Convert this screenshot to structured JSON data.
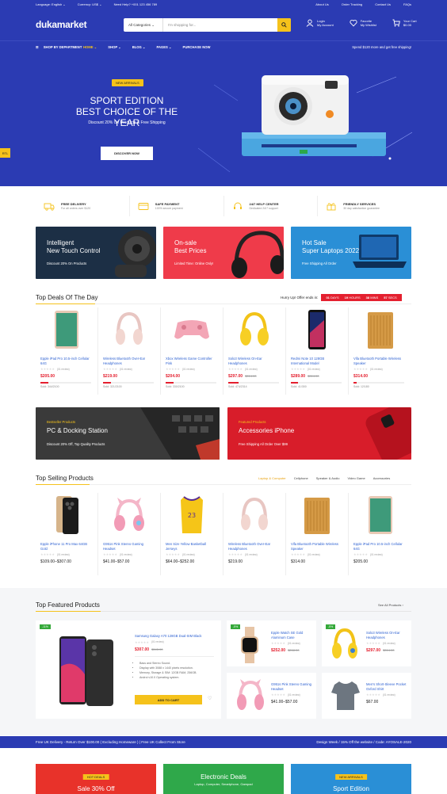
{
  "topbar": {
    "language": "Language: English ⌄",
    "currency": "Currency: US$ ⌄",
    "help": "Need Help? +001 123 456 789",
    "links": [
      "About Us",
      "Order Tracking",
      "Contact Us",
      "FAQs"
    ]
  },
  "header": {
    "logo": "dukamarket",
    "search": {
      "category": "All Categories",
      "placeholder": "I'm shopping for..."
    },
    "login": {
      "line1": "Login",
      "line2": "My Account"
    },
    "wishlist": {
      "line1": "Favorite",
      "line2": "My Wishlist",
      "count": "0"
    },
    "cart": {
      "line1": "Your Cart",
      "line2": "$0.00",
      "count": "0"
    }
  },
  "nav": {
    "dept": "SHOP BY DEPARTMENT",
    "items": [
      "HOME ⌄",
      "SHOP ⌄",
      "BLOG ⌄",
      "PAGES ⌄",
      "PURCHASE NOW"
    ],
    "promo": "Spend $120 more and get free shipping!"
  },
  "hero": {
    "badge": "NEW ARRIVALS",
    "line1": "SPORT EDITION",
    "line2": "BEST CHOICE OF THE YEAR",
    "sub": "Discount 20% On Products & Free Shipping",
    "cta": "DISCOVER NOW",
    "rtl": "RTL"
  },
  "services": [
    {
      "title": "FREE DELIVERY",
      "sub": "For all orders over $120"
    },
    {
      "title": "SAFE PAYMENT",
      "sub": "100% secure payment"
    },
    {
      "title": "24/7 HELP CENTER",
      "sub": "Dedicated 24/7 support"
    },
    {
      "title": "FRIENDLY SERVICES",
      "sub": "30 day satisfaction guarantee"
    }
  ],
  "promo_banners": [
    {
      "title": "Intelligent",
      "title2": "New Touch Control",
      "sub": "Discount 20% On Products"
    },
    {
      "title": "On-sale",
      "title2": "Best Prices",
      "sub": "Limited Time: Online Only!"
    },
    {
      "title": "Hot Sale",
      "title2": "Super Laptops 2022",
      "sub": "Free Shipping All Order"
    }
  ],
  "deals": {
    "title": "Top Deals Of The Day",
    "hurry": "Hurry Up! Offer ends in:",
    "countdown": {
      "days": "01",
      "days_label": "DAYS",
      "hours": "19",
      "hours_label": "HOURS",
      "mins": "38",
      "mins_label": "MINS",
      "secs": "57",
      "secs_label": "SECS"
    },
    "products": [
      {
        "name": "Epple iPad Pro 10.5-inch Cellular 64G",
        "reviews": "(01 review)",
        "price": "$205.00",
        "old": "",
        "sold": "Sold: 344/2100",
        "fill": 0.16
      },
      {
        "name": "Wireless Bluetooth Over-Ear Headphones",
        "reviews": "(01 review)",
        "price": "$219.00",
        "old": "",
        "sold": "Sold: 321/2100",
        "fill": 0.15
      },
      {
        "name": "Xbox Wireless Game Controller Pink",
        "reviews": "(01 review)",
        "price": "$204.00",
        "old": "",
        "sold": "Sold: 330/2100",
        "fill": 0.16
      },
      {
        "name": "Solo3 Wireless On-Ear Headphones",
        "reviews": "(01 review)",
        "price": "$297.00",
        "old": "$314.00",
        "sold": "Sold: 474/2314",
        "fill": 0.2
      },
      {
        "name": "Redmi Note 10 128GB International Model",
        "reviews": "(01 review)",
        "price": "$289.00",
        "old": "$314.00",
        "sold": "Sold: 41/300",
        "fill": 0.14
      },
      {
        "name": "Vifa Bluetooth Portable Wireless Speaker",
        "reviews": "(01 review)",
        "price": "$314.00",
        "old": "",
        "sold": "Sold: 12/180",
        "fill": 0.07
      }
    ]
  },
  "mid_banners": [
    {
      "tag": "Bestseller Products",
      "title": "PC & Docking Station",
      "sub": "Discount 20% Off, Top Quality Products"
    },
    {
      "tag": "Featured Products",
      "title": "Accessories iPhone",
      "sub": "Free Shipping All Order Over $99"
    }
  ],
  "selling": {
    "title": "Top Selling Products",
    "tabs": [
      "Laptop & Computer",
      "Cellphone",
      "Speaker & Audio",
      "Video Game",
      "Accessories"
    ],
    "products": [
      {
        "name": "Epple iPhone 11 Pro Max 64GB Gold",
        "reviews": "(01 review)",
        "price": "$109.00–$307.00"
      },
      {
        "name": "G951s Pink Stereo Gaming Headset",
        "reviews": "(01 review)",
        "price": "$41.00–$57.00"
      },
      {
        "name": "Men Size Yellow Basketball Jerseys",
        "reviews": "(01 review)",
        "price": "$64.00–$252.00"
      },
      {
        "name": "Wireless Bluetooth Over-Ear Headphones",
        "reviews": "(01 review)",
        "price": "$219.00"
      },
      {
        "name": "Vifa Bluetooth Portable Wireless Speaker",
        "reviews": "(01 review)",
        "price": "$314.00"
      },
      {
        "name": "Epple iPad Pro 10.5-inch Cellular 64G",
        "reviews": "(01 review)",
        "price": "$205.00"
      }
    ]
  },
  "featured": {
    "title": "Top Featured Products",
    "see_all": "See All Products ›",
    "main": {
      "tag": "-11%",
      "name": "Samsung Galaxy A70 128GB Dual-SIM Black",
      "reviews": "(01 review)",
      "price": "$307.00",
      "old": "$345.00",
      "specs": [
        "Bass and Stereo Sound.",
        "Display with 3088 x 1440 pixels resolution.",
        "Memory, Storage & SIM: 12GB RAM, 256GB.",
        "Androi v10.0 Operating system."
      ],
      "cta": "ADD TO CART"
    },
    "small": [
      {
        "tag": "-5%",
        "name": "Epple Watch SE Gold Aluminum Case",
        "reviews": "(01 review)",
        "price": "$252.00",
        "old": "$268.00"
      },
      {
        "tag": "-5%",
        "name": "Solo3 Wireless On-Ear Headphones",
        "reviews": "(01 review)",
        "price": "$297.00",
        "old": "$314.00"
      },
      {
        "tag": "",
        "name": "G951s Pink Stereo Gaming Headset",
        "reviews": "(01 review)",
        "price": "$41.00–$57.00",
        "old": ""
      },
      {
        "tag": "",
        "name": "Men's Short-Sleeve Pocket Oxford Shirt",
        "reviews": "(01 review)",
        "price": "$67.00",
        "old": ""
      }
    ]
  },
  "delivery": {
    "left": "Free UK Delivery - Return Over $100.00 ( Excluding Homeware ) | Free UK Collect From Store",
    "right": "Design Week / 15% Off the website / Code: AYOSALE-2020"
  },
  "bottom_banners": [
    {
      "tag": "HOT DEALS",
      "title": "Sale 30% Off",
      "sub": ""
    },
    {
      "tag": "",
      "title": "Electronic Deals",
      "sub": "Laptop, Computer, Smartphone, Gampad"
    },
    {
      "tag": "NEW ARRIVALS",
      "title": "Sport Edition",
      "sub": ""
    }
  ],
  "colors": {
    "brand": "#2b3bb3",
    "accent": "#f5c21b",
    "sale": "#e4202f",
    "link": "#2b5fd0"
  }
}
